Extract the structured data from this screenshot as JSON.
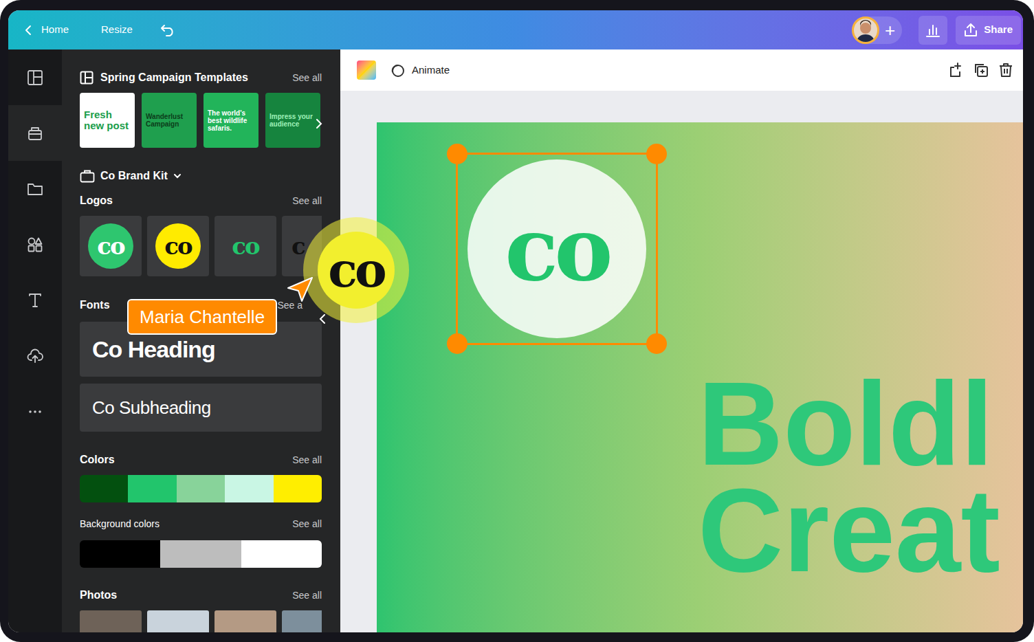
{
  "topbar": {
    "back_label": "Home",
    "resize": "Resize",
    "add": "+",
    "share": "Share"
  },
  "rail": [
    {
      "kind": "templates",
      "selected": false
    },
    {
      "kind": "brand",
      "selected": true
    },
    {
      "kind": "projects",
      "selected": false
    },
    {
      "kind": "elements",
      "selected": false
    },
    {
      "kind": "text",
      "selected": false
    },
    {
      "kind": "uploads",
      "selected": false
    },
    {
      "kind": "more",
      "selected": false
    }
  ],
  "panel": {
    "templates": {
      "title": "Spring Campaign Templates",
      "see_all": "See all",
      "items": [
        {
          "text": "Fresh new post",
          "color": "#ffffff",
          "text_color": "#1a9e4b"
        },
        {
          "text": "Wanderlust Campaign",
          "color": "#1f9f4e",
          "text_color": "#0b3d1a"
        },
        {
          "text": "The world's best wildlife safaris.",
          "color": "#22b45a",
          "text_color": "#ffffff"
        },
        {
          "text": "Impress your audience",
          "color": "#16843e",
          "text_color": "#9ff0b8"
        }
      ]
    },
    "brand_kit": "Co Brand Kit",
    "logos": {
      "title": "Logos",
      "see_all": "See all",
      "items": [
        {
          "text": "co",
          "kind": "circle",
          "color": "#2ec66f",
          "text_color": "#ffffff"
        },
        {
          "text": "co",
          "kind": "circle",
          "color": "#ffeb00",
          "text_color": "#111111"
        },
        {
          "text": "co",
          "kind": "plain",
          "color": "#3a3b3d",
          "text_color": "#22c56c"
        },
        {
          "text": "c",
          "kind": "plain",
          "color": "#3a3b3d",
          "text_color": "#111111"
        }
      ]
    },
    "fonts": {
      "title": "Fonts",
      "see_all": "See a",
      "items": [
        {
          "text": "Co Heading",
          "kind": "heading"
        },
        {
          "text": "Co Subheading",
          "kind": "subheading"
        }
      ]
    },
    "colors": {
      "title": "Colors",
      "see_all": "See all",
      "swatches": [
        {
          "color": "#03500f"
        },
        {
          "color": "#22c56c"
        },
        {
          "color": "#88d39a"
        },
        {
          "color": "#c9f6e4"
        },
        {
          "color": "#ffee00"
        }
      ]
    },
    "background_colors": {
      "title": "Background colors",
      "see_all": "See all",
      "swatches": [
        {
          "color": "#000000"
        },
        {
          "color": "#bdbdbd"
        },
        {
          "color": "#ffffff"
        }
      ]
    },
    "photos": {
      "title": "Photos",
      "see_all": "See all",
      "items": [
        {
          "color": "#6e6258"
        },
        {
          "color": "#c9d3dc"
        },
        {
          "color": "#b49a84"
        },
        {
          "color": "#7d8f9c"
        }
      ]
    }
  },
  "toolbar": {
    "animate": "Animate"
  },
  "canvas": {
    "logo": {
      "text": "co",
      "selected": true
    },
    "headline": [
      "Boldl",
      "Creat"
    ]
  },
  "dragged_logo": {
    "text": "co"
  },
  "collaborator": {
    "name": "Maria Chantelle",
    "color": "#ff8a00"
  }
}
